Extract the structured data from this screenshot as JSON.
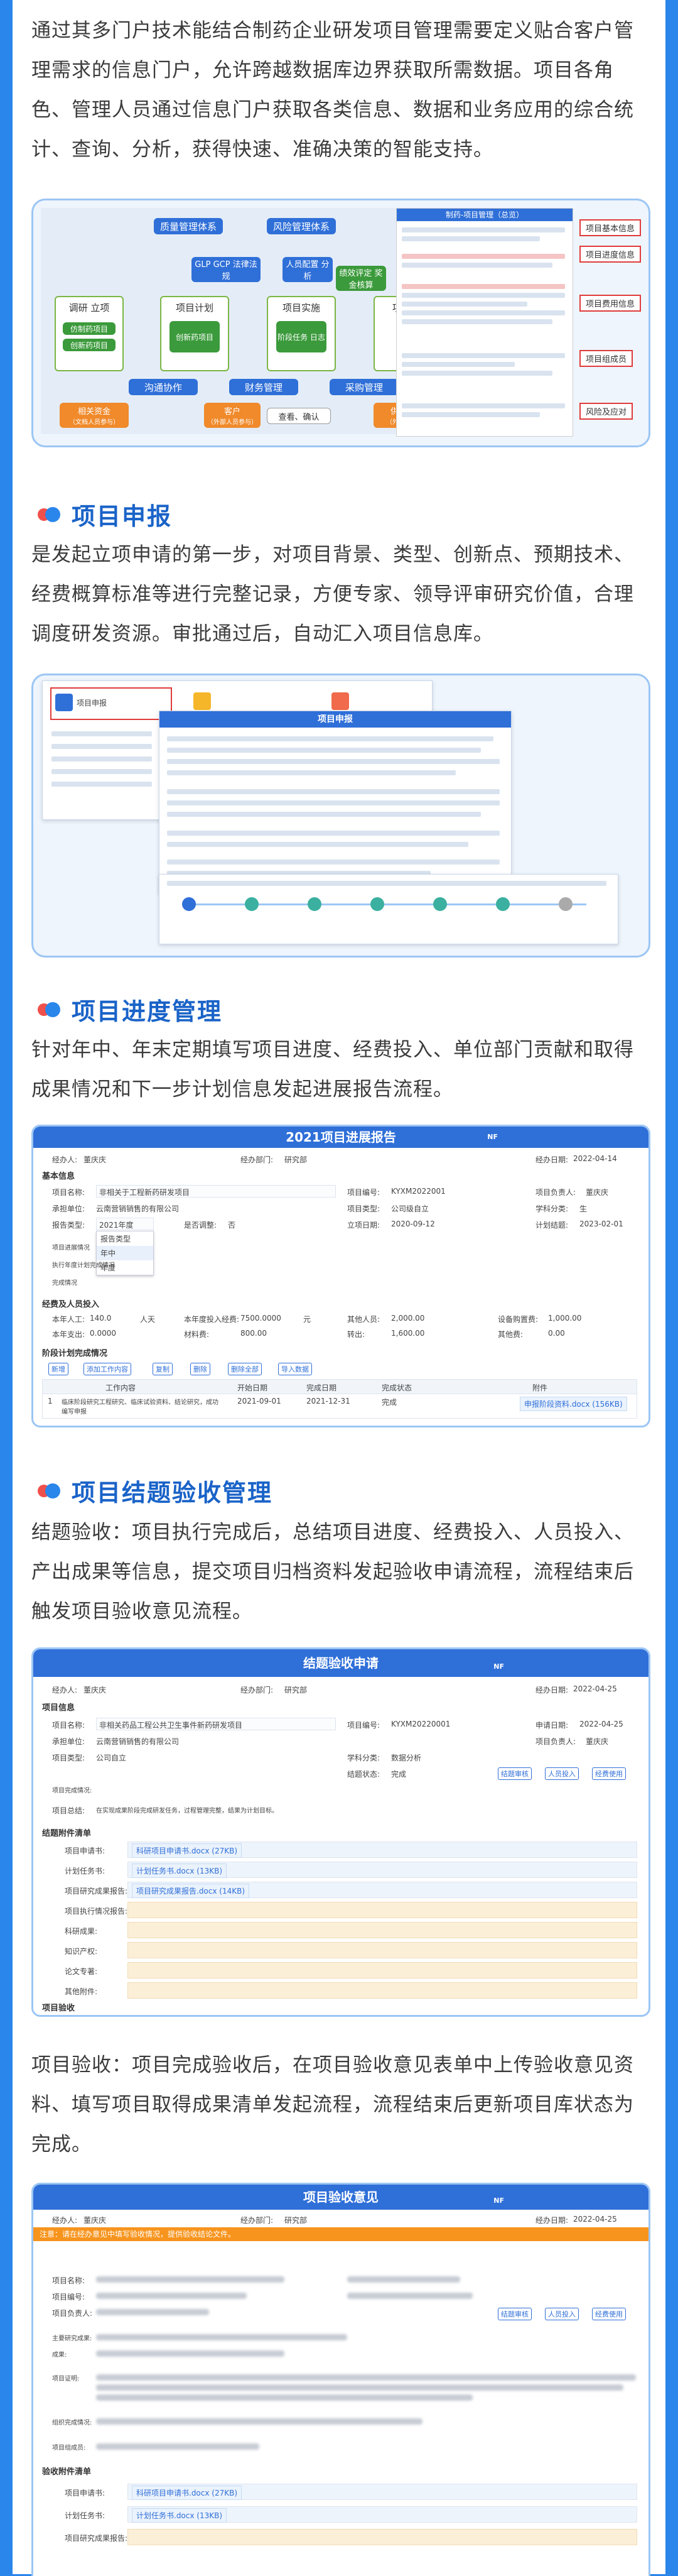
{
  "intro": {
    "text": "通过其多门户技术能结合制药企业研发项目管理需要定义贴合客户管理需求的信息门户，允许跨越数据库边界获取所需数据。项目各角色、管理人员通过信息门户获取各类信息、数据和业务应用的综合统计、查询、分析，获得快速、准确决策的智能支持。"
  },
  "diagram": {
    "top_boxes": [
      "质量管理体系",
      "风险管理体系"
    ],
    "mid_boxes": [
      "GLP GCP 法律法规",
      "人员配置 分析",
      "绩效评定 奖金核算"
    ],
    "flow": [
      "调研 立项",
      "项目计划",
      "项目实施",
      "项目"
    ],
    "flow_sub": [
      "仿制药项目",
      "创新药项目",
      "创新药项目",
      "阶段任务 日志"
    ],
    "plan_sub": "创新药项目",
    "bottom": [
      "沟通协作",
      "财务管理",
      "采购管理"
    ],
    "bottom2": [
      "相关资金",
      "客户",
      "查看、确认",
      "供应"
    ],
    "bottom2_sub": [
      "（文档人员参与）",
      "（外部人员参与）",
      "",
      "（外部）"
    ],
    "panel_title": "制药-项目管理（总览）",
    "right_labels": [
      "项目基本信息",
      "项目进度信息",
      "项目费用信息",
      "项目组成员",
      "风险及应对"
    ]
  },
  "sec1": {
    "title": "项目申报",
    "text": "是发起立项申请的第一步，对项目背景、类型、创新点、预期技术、经费概算标准等进行完整记录，方便专家、领导评审研究价值，合理调度研发资源。审批通过后，自动汇入项目信息库。",
    "window_title": "项目申报",
    "app_tabs": [
      "项目申报",
      "",
      ""
    ]
  },
  "sec2": {
    "title": "项目进度管理",
    "text": "针对年中、年末定期填写项目进度、经费投入、单位部门贡献和取得成果情况和下一步计划信息发起进展报告流程。",
    "window_title": "2021项目进展报告",
    "no_label": "NF",
    "row1": [
      [
        "经办人:",
        "董庆庆"
      ],
      [
        "经办部门:",
        "研究部"
      ],
      [
        "经办日期:",
        "2022-04-14"
      ]
    ],
    "basic_info": "基本信息",
    "fields": [
      [
        "项目名称:",
        "非相关于工程新药研发项目"
      ],
      [
        "项目编号:",
        "KYXM2022001"
      ],
      [
        "项目负责人:",
        "董庆庆"
      ],
      [
        "承担单位:",
        "云南营销销售的有限公司"
      ],
      [
        "项目类型:",
        "公司级自立"
      ],
      [
        "学科分类:",
        "生"
      ],
      [
        "报告类型:",
        "2021年度"
      ],
      [
        "是否调整:",
        "否"
      ],
      [
        "立项日期:",
        "2020-09-12"
      ],
      [
        "计划结题:",
        "2023-02-01"
      ]
    ],
    "dropdown": [
      "报告类型",
      "年中",
      "年度"
    ],
    "side_labels": [
      "项目进展情况",
      "执行年度计划完成情况",
      "完成情况"
    ],
    "funds_title": "经费及人员投入",
    "funds": [
      [
        "本年人工:",
        "140.0",
        "人天"
      ],
      [
        "本年度投入经费:",
        "7500.0000",
        "元"
      ],
      [
        "其他人员:",
        "2,000.00"
      ],
      [
        "设备购置费:",
        "1,000.00"
      ],
      [
        "本年支出:",
        "0.0000"
      ],
      [
        "材料费:",
        "800.00"
      ],
      [
        "转出:",
        "1,600.00"
      ],
      [
        "其他费:",
        "0.00"
      ]
    ],
    "next_title": "阶段计划完成情况",
    "toolbar": [
      "新增",
      "添加工作内容",
      "复制",
      "删除",
      "删除全部",
      "导入数据"
    ],
    "table_headers": [
      "工作内容",
      "开始日期",
      "完成日期",
      "完成状态",
      "附件"
    ],
    "table_row": [
      "1",
      "临床阶段研究工程研究、临床试验资料、结论研究，成功编写申报",
      "2021-09-01",
      "2021-12-31",
      "完成",
      "申报阶段资料.docx (156KB)"
    ]
  },
  "sec3": {
    "title": "项目结题验收管理",
    "text": "结题验收：项目执行完成后，总结项目进度、经费投入、人员投入、产出成果等信息，提交项目归档资料发起验收申请流程，流程结束后触发项目验收意见流程。",
    "window_title": "结题验收申请",
    "no_label": "NF",
    "row1": [
      [
        "经办人:",
        "董庆庆"
      ],
      [
        "经办部门:",
        "研究部"
      ],
      [
        "经办日期:",
        "2022-04-25"
      ]
    ],
    "basic_info": "项目信息",
    "fields": [
      [
        "项目名称:",
        "非相关药品工程公共卫生事件新药研发项目"
      ],
      [
        "项目编号:",
        "KYXM20220001"
      ],
      [
        "申请日期:",
        "2022-04-25"
      ],
      [
        "承担单位:",
        "云南营销销售的有限公司"
      ],
      [
        "项目负责人:",
        "董庆庆"
      ],
      [
        "项目类型:",
        "公司自立"
      ],
      [
        "学科分类:",
        "数据分析"
      ],
      [
        "结题状态:",
        "完成"
      ]
    ],
    "buttons": [
      "结题审核",
      "人员投入",
      "经费使用"
    ],
    "side_labels": [
      "项目完成情况:",
      "项目总结:"
    ],
    "summary": "在实现成果阶段完成研发任务，过程管理完整，结果为计划目标。",
    "att_title": "结题附件清单",
    "att_rows": [
      "项目申请书:",
      "计划任务书:",
      "项目研究成果报告:",
      "项目执行情况报告:",
      "科研成果:",
      "知识产权:",
      "论文专著:",
      "其他附件:"
    ],
    "files": [
      "科研项目申请书.docx (27KB)",
      "计划任务书.docx (13KB)",
      "项目研究成果报告.docx (14KB)"
    ],
    "footer": "项目验收",
    "text2": "项目验收：项目完成验收后，在项目验收意见表单中上传验收意见资料、填写项目取得成果清单发起流程，流程结束后更新项目库状态为完成。",
    "window2_title": "项目验收意见",
    "notice": "注意：请在经办意见中填写验收情况，提供验收结论文件。",
    "row2": [
      [
        "经办人:",
        "董庆庆"
      ],
      [
        "经办部门:",
        "研究部"
      ],
      [
        "经办日期:",
        "2022-04-25"
      ]
    ],
    "side2": [
      "项目名称:",
      "项目编号:",
      "项目负责人:",
      "主要研究成果:",
      "成果:",
      "项目证明:",
      "组织完成情况:",
      "项目组成员:"
    ],
    "buttons2": [
      "结题审核",
      "人员投入",
      "经费使用"
    ],
    "att2_title": "验收附件清单",
    "att2_rows": [
      "项目申请书:",
      "计划任务书:",
      "项目研究成果报告:"
    ],
    "files2": [
      "科研项目申请书.docx (27KB)",
      "计划任务书.docx (13KB)"
    ]
  }
}
